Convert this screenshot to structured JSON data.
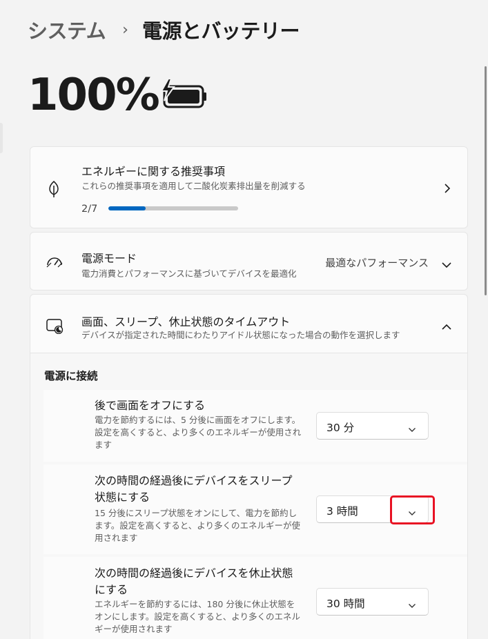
{
  "header": {
    "parent": "システム",
    "separator": "›",
    "current": "電源とバッテリー"
  },
  "battery": {
    "percent": "100%",
    "icon": "battery-charging-icon",
    "charging": true,
    "level": 1.0
  },
  "energy_card": {
    "icon": "leaf-icon",
    "title": "エネルギーに関する推奨事項",
    "subtitle": "これらの推奨事項を適用して二酸化炭素排出量を削減する",
    "progress_label": "2/7",
    "progress_fraction": 0.2857,
    "chevron": "chevron-right-icon"
  },
  "power_mode_card": {
    "icon": "speedometer-icon",
    "title": "電源モード",
    "subtitle": "電力消費とパフォーマンスに基づいてデバイスを最適化",
    "value": "最適なパフォーマンス",
    "chevron": "chevron-down-icon"
  },
  "timeout_card": {
    "icon": "screen-sleep-icon",
    "title": "画面、スリープ、休止状態のタイムアウト",
    "subtitle": "デバイスが指定された時間にわたりアイドル状態になった場合の動作を選択します",
    "chevron": "chevron-up-icon"
  },
  "section": {
    "title": "電源に接続"
  },
  "settings": [
    {
      "title": "後で画面をオフにする",
      "description": "電力を節約するには、5 分後に画面をオフにします。設定を高くすると、より多くのエネルギーが使用されます",
      "value": "30 分"
    },
    {
      "title": "次の時間の経過後にデバイスをスリープ状態にする",
      "description": "15 分後にスリープ状態をオンにして、電力を節約します。設定を高くすると、より多くのエネルギーが使用されます",
      "value": "3 時間"
    },
    {
      "title": "次の時間の経過後にデバイスを休止状態にする",
      "description": "エネルギーを節約するには、180 分後に休止状態をオンにします。設定を高くすると、より多くのエネルギーが使用されます",
      "value": "30 時間"
    }
  ],
  "colors": {
    "accent": "#0067c0",
    "highlight": "#e81123"
  }
}
